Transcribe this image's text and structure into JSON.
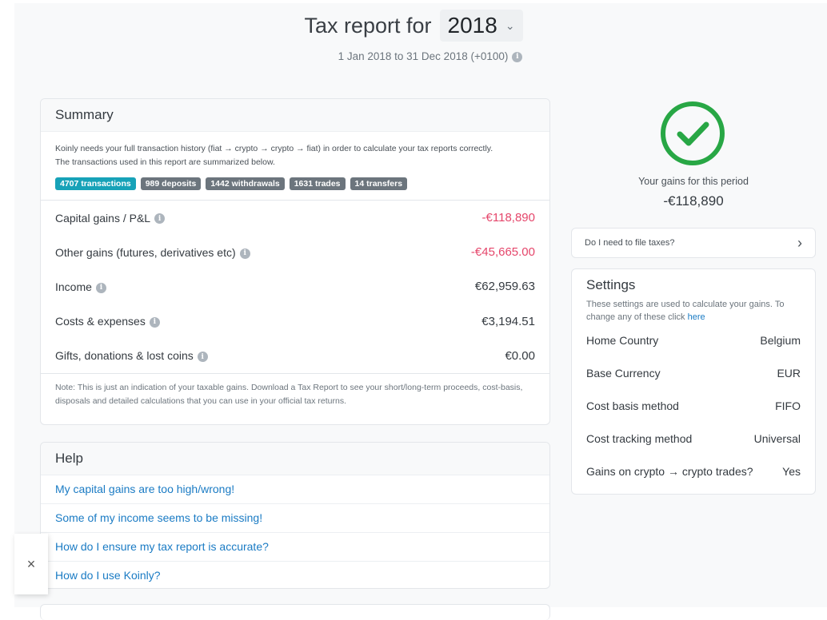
{
  "header": {
    "title": "Tax report for",
    "year": "2018",
    "date_range": "1 Jan 2018 to 31 Dec 2018 (+0100)"
  },
  "summary": {
    "title": "Summary",
    "intro_line1": "Koinly needs your full transaction history (fiat → crypto → crypto → fiat) in order to calculate your tax reports correctly.",
    "intro_line2": "The transactions used in this report are summarized below.",
    "badges": [
      "4707 transactions",
      "989 deposits",
      "1442 withdrawals",
      "1631 trades",
      "14 transfers"
    ],
    "rows": [
      {
        "label": "Capital gains / P&L",
        "value": "-€118,890"
      },
      {
        "label": "Other gains (futures, derivatives etc)",
        "value": "-€45,665.00"
      },
      {
        "label": "Income",
        "value": "€62,959.63"
      },
      {
        "label": "Costs & expenses",
        "value": "€3,194.51"
      },
      {
        "label": "Gifts, donations & lost coins",
        "value": "€0.00"
      }
    ],
    "note": "Note: This is just an indication of your taxable gains. Download a Tax Report to see your short/long-term proceeds, cost-basis, disposals and detailed calculations that you can use in your official tax returns."
  },
  "help": {
    "title": "Help",
    "items": [
      "My capital gains are too high/wrong!",
      "Some of my income seems to be missing!",
      "How do I ensure my tax report is accurate?",
      "How do I use Koinly?"
    ]
  },
  "gains": {
    "label": "Your gains for this period",
    "value": "-€118,890"
  },
  "file_taxes": {
    "label": "Do I need to file taxes?"
  },
  "settings": {
    "title": "Settings",
    "desc": "These settings are used to calculate your gains. To change any of these click",
    "link": "here",
    "rows": [
      {
        "label": "Home Country",
        "value": "Belgium"
      },
      {
        "label": "Base Currency",
        "value": "EUR"
      },
      {
        "label": "Cost basis method",
        "value": "FIFO"
      },
      {
        "label": "Cost tracking method",
        "value": "Universal"
      },
      {
        "label": "Gains on crypto → crypto trades?",
        "value": "Yes"
      }
    ]
  },
  "close": {
    "symbol": "×"
  },
  "colors": {
    "negative": "#e5466b",
    "link": "#1a7bc4",
    "success": "#28a745",
    "primary_badge": "#17a2b8"
  }
}
